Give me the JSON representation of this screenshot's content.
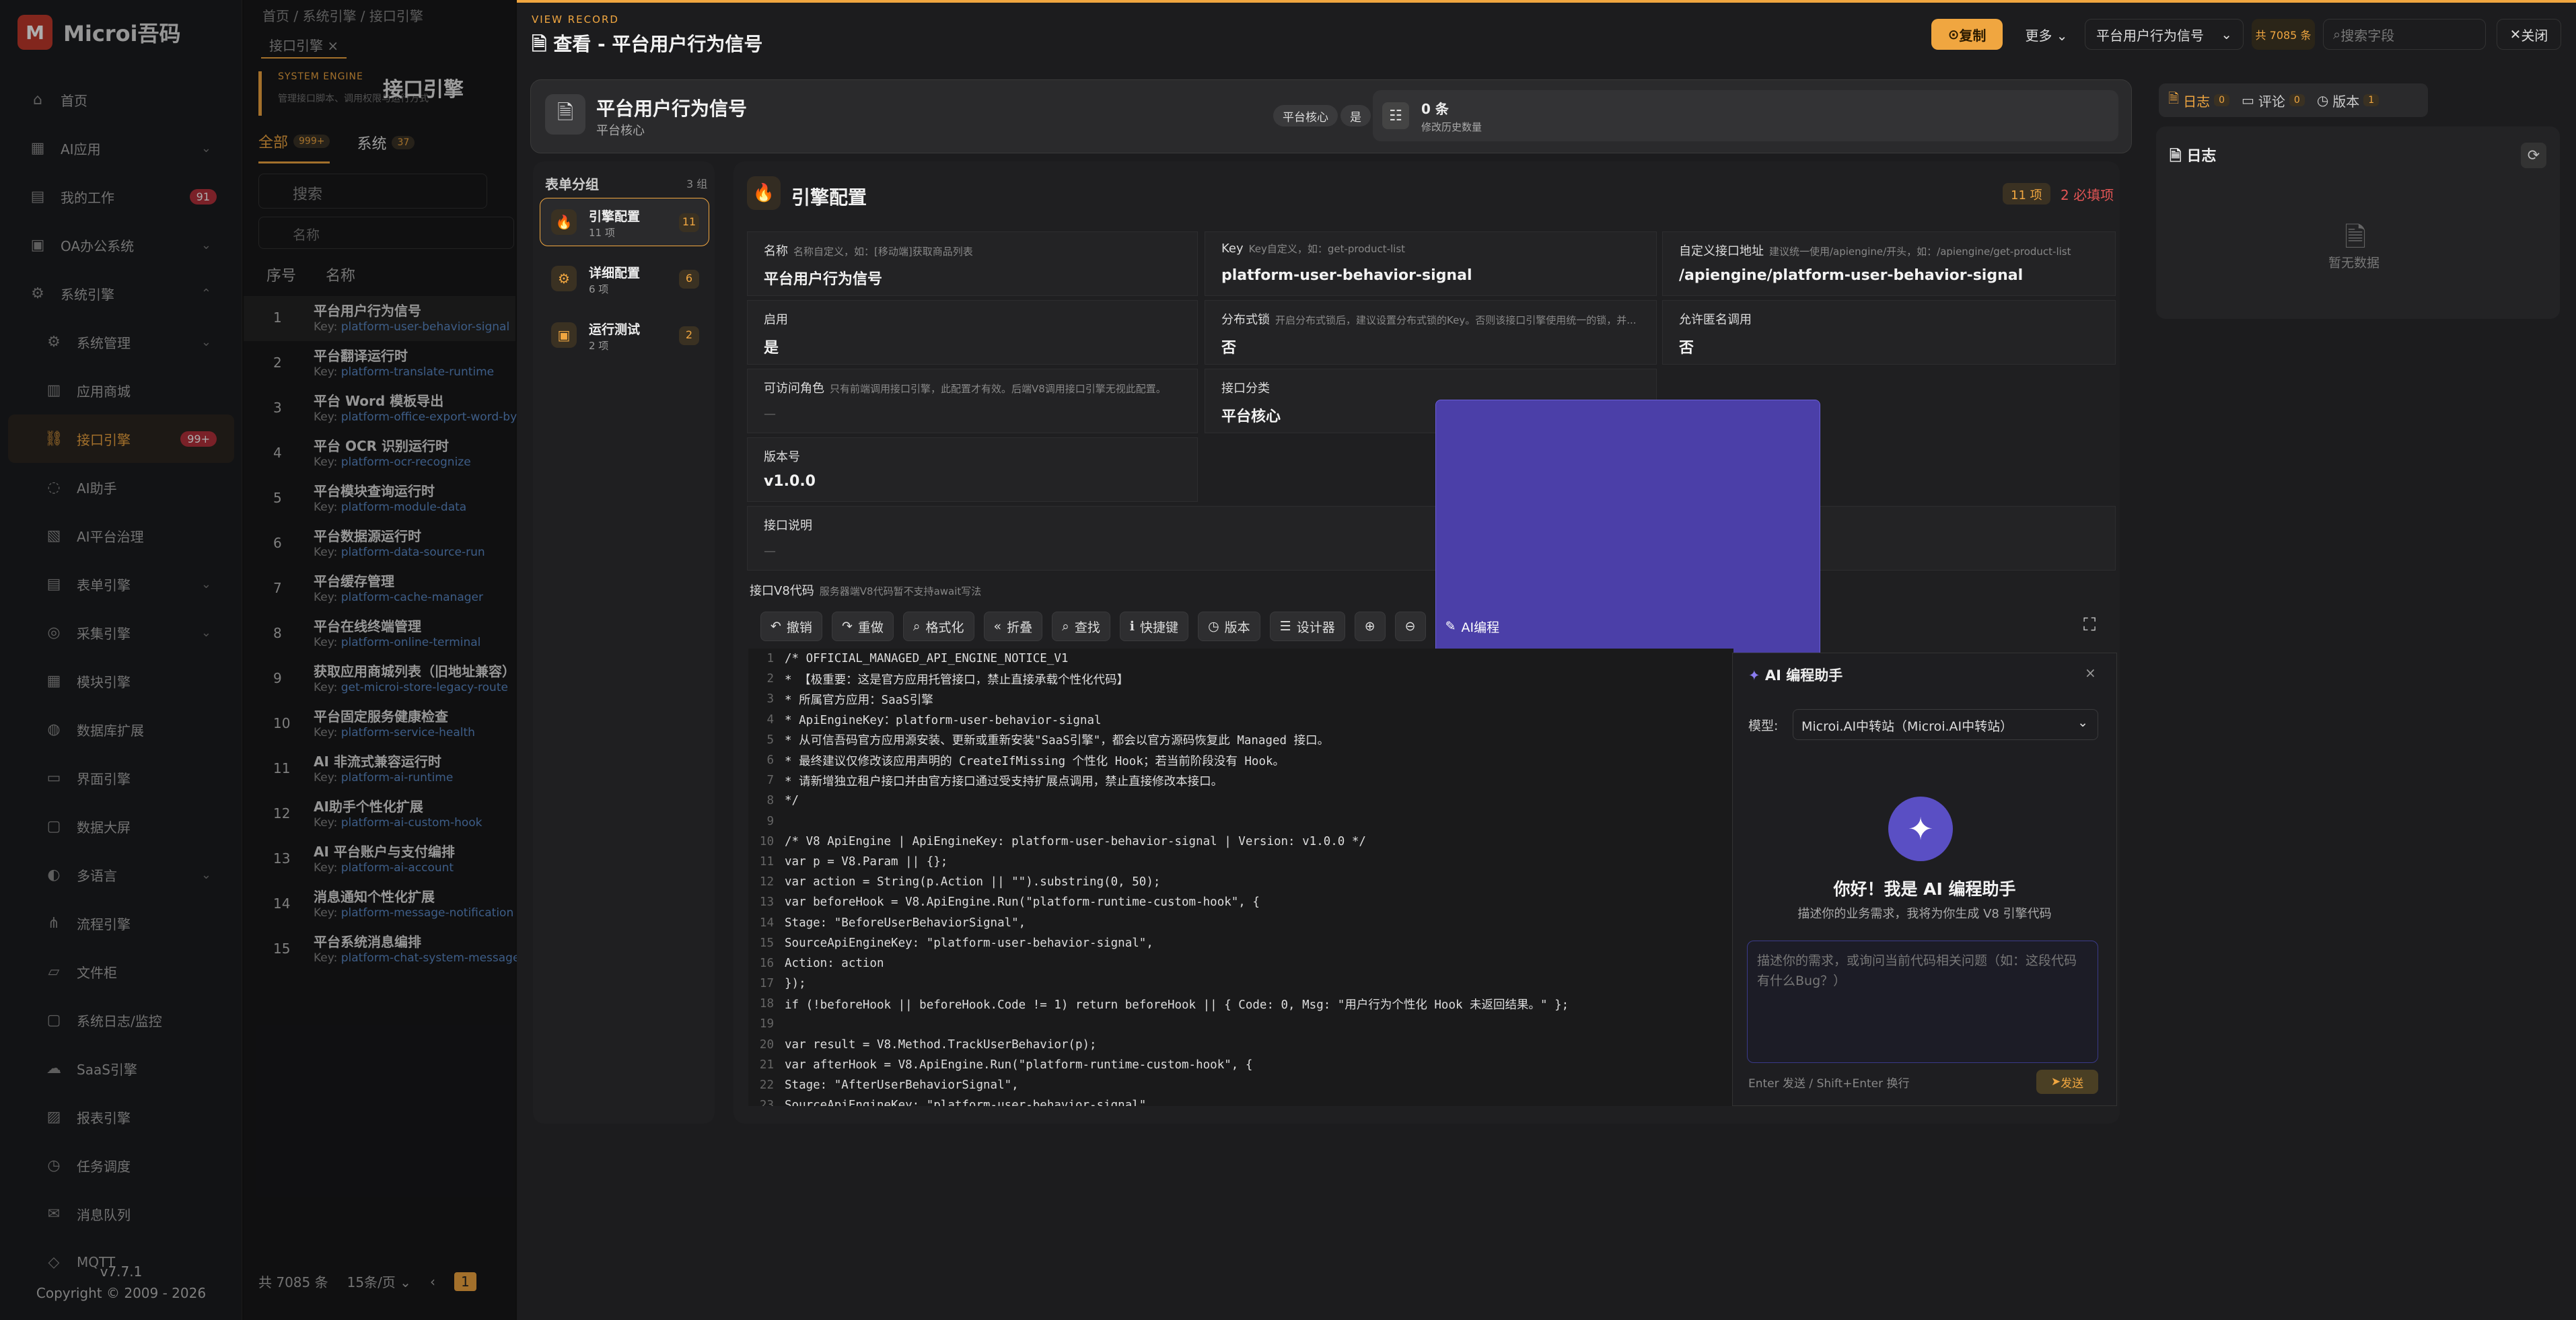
{
  "app": {
    "name": "Microi吾码",
    "version": "v7.7.1",
    "copyright": "Copyright © 2009 - 2026"
  },
  "sidebar": {
    "items": [
      {
        "label": "首页",
        "icon": "home-icon",
        "chev": ""
      },
      {
        "label": "AI应用",
        "icon": "grid-icon",
        "chev": "⌄"
      },
      {
        "label": "我的工作",
        "icon": "doc-icon",
        "badge": "91"
      },
      {
        "label": "OA办公系统",
        "icon": "briefcase-icon",
        "chev": "⌄"
      },
      {
        "label": "系统引擎",
        "icon": "gear-icon",
        "chev": "⌃"
      },
      {
        "label": "系统管理",
        "icon": "gear-icon",
        "chev": "⌄",
        "sub": true
      },
      {
        "label": "应用商城",
        "icon": "store-icon",
        "sub": true
      },
      {
        "label": "接口引擎",
        "icon": "link-icon",
        "badge": "99+",
        "sub": true,
        "active": true
      },
      {
        "label": "AI助手",
        "icon": "chat-icon",
        "sub": true
      },
      {
        "label": "AI平台治理",
        "icon": "clipboard-icon",
        "sub": true
      },
      {
        "label": "表单引擎",
        "icon": "form-icon",
        "chev": "⌄",
        "sub": true
      },
      {
        "label": "采集引擎",
        "icon": "target-icon",
        "chev": "⌄",
        "sub": true
      },
      {
        "label": "模块引擎",
        "icon": "module-icon",
        "sub": true
      },
      {
        "label": "数据库扩展",
        "icon": "database-icon",
        "sub": true
      },
      {
        "label": "界面引擎",
        "icon": "layout-icon",
        "sub": true
      },
      {
        "label": "数据大屏",
        "icon": "monitor-icon",
        "sub": true
      },
      {
        "label": "多语言",
        "icon": "language-icon",
        "chev": "⌄",
        "sub": true
      },
      {
        "label": "流程引擎",
        "icon": "flow-icon",
        "sub": true
      },
      {
        "label": "文件柜",
        "icon": "folder-icon",
        "sub": true
      },
      {
        "label": "系统日志/监控",
        "icon": "monitor-icon",
        "sub": true
      },
      {
        "label": "SaaS引擎",
        "icon": "cloud-icon",
        "sub": true
      },
      {
        "label": "报表引擎",
        "icon": "report-icon",
        "sub": true
      },
      {
        "label": "任务调度",
        "icon": "clock-icon",
        "sub": true
      },
      {
        "label": "消息队列",
        "icon": "message-icon",
        "sub": true
      },
      {
        "label": "MQTT",
        "icon": "mqtt-icon",
        "sub": true
      }
    ]
  },
  "list": {
    "breadcrumb": "首页  /  系统引擎  /  接口引擎",
    "tab": "接口引擎  ×",
    "engine_label": "SYSTEM ENGINE",
    "engine_title": "接口引擎",
    "engine_desc": "管理接口脚本、调用权限与运行方式",
    "tab_all": "全部",
    "tab_all_count": "999+",
    "tab_sys": "系统",
    "tab_sys_count": "37",
    "search_placeholder": "搜索",
    "name_placeholder": "名称",
    "col_no": "序号",
    "col_name": "名称",
    "rows": [
      {
        "no": "1",
        "name": "平台用户行为信号",
        "key": "platform-user-behavior-signal"
      },
      {
        "no": "2",
        "name": "平台翻译运行时",
        "key": "platform-translate-runtime"
      },
      {
        "no": "3",
        "name": "平台 Word 模板导出",
        "key": "platform-office-export-word-by"
      },
      {
        "no": "4",
        "name": "平台 OCR 识别运行时",
        "key": "platform-ocr-recognize"
      },
      {
        "no": "5",
        "name": "平台模块查询运行时",
        "key": "platform-module-data"
      },
      {
        "no": "6",
        "name": "平台数据源运行时",
        "key": "platform-data-source-run"
      },
      {
        "no": "7",
        "name": "平台缓存管理",
        "key": "platform-cache-manager"
      },
      {
        "no": "8",
        "name": "平台在线终端管理",
        "key": "platform-online-terminal"
      },
      {
        "no": "9",
        "name": "获取应用商城列表（旧地址兼容）",
        "key": "get-microi-store-legacy-route"
      },
      {
        "no": "10",
        "name": "平台固定服务健康检查",
        "key": "platform-service-health"
      },
      {
        "no": "11",
        "name": "AI 非流式兼容运行时",
        "key": "platform-ai-runtime"
      },
      {
        "no": "12",
        "name": "AI助手个性化扩展",
        "key": "platform-ai-custom-hook"
      },
      {
        "no": "13",
        "name": "AI 平台账户与支付编排",
        "key": "platform-ai-account"
      },
      {
        "no": "14",
        "name": "消息通知个性化扩展",
        "key": "platform-message-notification"
      },
      {
        "no": "15",
        "name": "平台系统消息编排",
        "key": "platform-chat-system-message"
      }
    ],
    "footer_total": "共 7085 条",
    "footer_pagesize": "15条/页  ⌄",
    "footer_page": "1"
  },
  "modal": {
    "view_record": "VIEW RECORD",
    "title": "查看 - 平台用户行为信号",
    "copy": "复制",
    "more": "更多  ⌄",
    "record_select": "平台用户行为信号",
    "total": "共 7085 条",
    "field_search": "搜索字段",
    "close": "关闭",
    "header_title": "平台用户行为信号",
    "header_sub": "平台核心",
    "tag1": "平台核心",
    "tag2": "是",
    "hist_count": "0 条",
    "hist_label": "修改历史数量",
    "groups_title": "表单分组",
    "groups_count": "3 组",
    "groups": [
      {
        "name": "引擎配置",
        "sub": "11 项",
        "count": "11",
        "active": true
      },
      {
        "name": "详细配置",
        "sub": "6 项",
        "count": "6"
      },
      {
        "name": "运行测试",
        "sub": "2 项",
        "count": "2"
      }
    ],
    "section_title": "引擎配置",
    "section_items": "11 项",
    "section_required": "2 必填项",
    "fields": {
      "name_label": "名称",
      "name_hint": "名称自定义，如：[移动端]获取商品列表",
      "name_val": "平台用户行为信号",
      "key_label": "Key",
      "key_hint": "Key自定义，如：get-product-list",
      "key_val": "platform-user-behavior-signal",
      "url_label": "自定义接口地址",
      "url_hint": "建议统一使用/apiengine/开头，如：/apiengine/get-product-list",
      "url_val": "/apiengine/platform-user-behavior-signal",
      "enable_label": "启用",
      "enable_val": "是",
      "lock_label": "分布式锁",
      "lock_hint": "开启分布式锁后，建议设置分布式锁的Key。否则该接口引擎使用统一的锁，并...",
      "lock_val": "否",
      "anon_label": "允许匿名调用",
      "anon_val": "否",
      "role_label": "可访问角色",
      "role_hint": "只有前端调用接口引擎，此配置才有效。后端V8调用接口引擎无视此配置。",
      "role_val": "—",
      "cat_label": "接口分类",
      "cat_val": "平台核心",
      "ver_label": "版本号",
      "ver_val": "v1.0.0",
      "desc_label": "接口说明",
      "desc_val": "—",
      "code_label": "接口V8代码",
      "code_hint": "服务器端V8代码暂不支持await写法"
    },
    "editor_buttons": [
      {
        "label": "撤销",
        "icon": "undo-icon",
        "glyph": "↶"
      },
      {
        "label": "重做",
        "icon": "redo-icon",
        "glyph": "↷"
      },
      {
        "label": "格式化",
        "icon": "search-icon",
        "glyph": "⌕"
      },
      {
        "label": "折叠",
        "icon": "fold-icon",
        "glyph": "«"
      },
      {
        "label": "查找",
        "icon": "search-icon",
        "glyph": "⌕"
      },
      {
        "label": "快捷键",
        "icon": "info-icon",
        "glyph": "ℹ"
      },
      {
        "label": "版本",
        "icon": "clock-icon",
        "glyph": "◷"
      },
      {
        "label": "设计器",
        "icon": "sliders-icon",
        "glyph": "☰"
      },
      {
        "label": "",
        "icon": "zoom-in-icon",
        "glyph": "⊕"
      },
      {
        "label": "",
        "icon": "zoom-out-icon",
        "glyph": "⊖"
      },
      {
        "label": "AI编程",
        "icon": "chat-icon",
        "glyph": "✎",
        "ai": true
      }
    ],
    "ai": {
      "title": "AI 编程助手",
      "model_label": "模型:",
      "model_value": "Microi.AI中转站（Microi.AI中转站）",
      "hello": "你好！我是 AI 编程助手",
      "desc": "描述你的业务需求，我将为你生成 V8 引擎代码",
      "placeholder": "描述你的需求，或询问当前代码相关问题（如：这段代码有什么Bug？）",
      "hint": "Enter 发送 / Shift+Enter 换行",
      "send": "发送"
    }
  },
  "code": [
    {
      "n": "1",
      "t": "/* OFFICIAL_MANAGED_API_ENGINE_NOTICE_V1",
      "c": "cm"
    },
    {
      "n": "2",
      "t": " * 【极重要：这是官方应用托管接口，禁止直接承载个性化代码】",
      "c": "cm"
    },
    {
      "n": "3",
      "t": " * 所属官方应用：SaaS引擎",
      "c": "cm"
    },
    {
      "n": "4",
      "t": " * ApiEngineKey：platform-user-behavior-signal",
      "c": "cm"
    },
    {
      "n": "5",
      "t": " * 从可信吾码官方应用源安装、更新或重新安装\"SaaS引擎\"，都会以官方源码恢复此 Managed 接口。",
      "c": "cm"
    },
    {
      "n": "6",
      "t": " * 最终建议仅修改该应用声明的 CreateIfMissing 个性化 Hook；若当前阶段没有 Hook。",
      "c": "cm"
    },
    {
      "n": "7",
      "t": " * 请新增独立租户接口并由官方接口通过受支持扩展点调用，禁止直接修改本接口。",
      "c": "cm"
    },
    {
      "n": "8",
      "t": " */",
      "c": "cm"
    },
    {
      "n": "9",
      "t": "",
      "c": ""
    },
    {
      "n": "10",
      "t": "/* V8 ApiEngine | ApiEngineKey: platform-user-behavior-signal | Version: v1.0.0 */",
      "c": "cm"
    },
    {
      "n": "11",
      "t": "var p = V8.Param || {};",
      "c": "kw"
    },
    {
      "n": "12",
      "t": "var action = String(p.Action || \"\").substring(0, 50);",
      "c": "kw"
    },
    {
      "n": "13",
      "t": "var beforeHook = V8.ApiEngine.Run(\"platform-runtime-custom-hook\", {",
      "c": "kw"
    },
    {
      "n": "14",
      "t": "    Stage: \"BeforeUserBehaviorSignal\",",
      "c": "pr"
    },
    {
      "n": "15",
      "t": "    SourceApiEngineKey: \"platform-user-behavior-signal\",",
      "c": "pr"
    },
    {
      "n": "16",
      "t": "    Action: action",
      "c": "pr"
    },
    {
      "n": "17",
      "t": "});",
      "c": "tx"
    },
    {
      "n": "18",
      "t": "if (!beforeHook || beforeHook.Code != 1) return beforeHook || { Code: 0, Msg: \"用户行为个性化 Hook 未返回结果。\" };",
      "c": "kw"
    },
    {
      "n": "19",
      "t": "",
      "c": ""
    },
    {
      "n": "20",
      "t": "var result = V8.Method.TrackUserBehavior(p);",
      "c": "kw"
    },
    {
      "n": "21",
      "t": "var afterHook = V8.ApiEngine.Run(\"platform-runtime-custom-hook\", {",
      "c": "kw"
    },
    {
      "n": "22",
      "t": "    Stage: \"AfterUserBehaviorSignal\",",
      "c": "pr"
    },
    {
      "n": "23",
      "t": "    SourceApiEngineKey: \"platform-user-behavior-signal\",",
      "c": "pr"
    }
  ],
  "right": {
    "tab_log": "日志",
    "tab_log_count": "0",
    "tab_comment": "评论",
    "tab_comment_count": "0",
    "tab_version": "版本",
    "tab_version_count": "1",
    "panel_title": "日志",
    "empty": "暂无数据"
  },
  "colors": {
    "accent": "#f0a640",
    "danger": "#e25555",
    "ai": "#5a4fc4"
  }
}
